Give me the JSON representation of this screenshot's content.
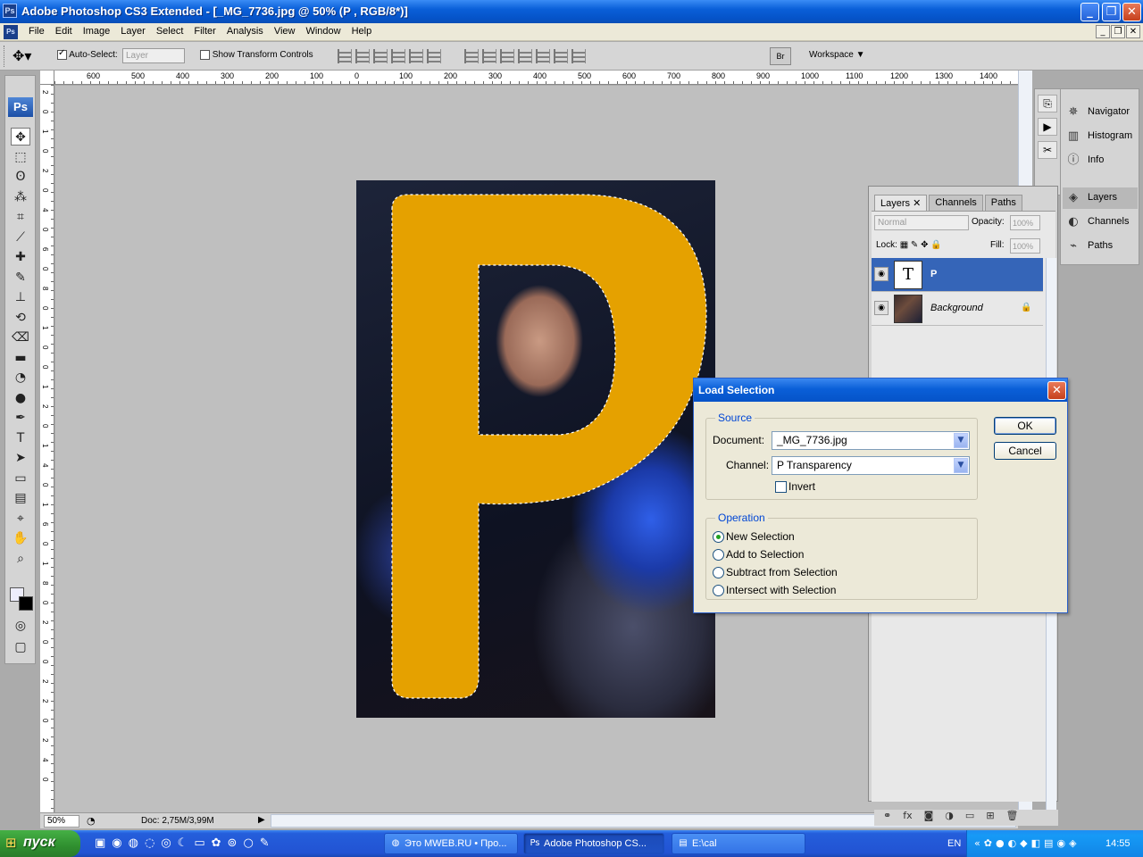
{
  "window": {
    "title": "Adobe Photoshop CS3 Extended - [_MG_7736.jpg @ 50% (P , RGB/8*)]",
    "app_badge": "Ps",
    "minimize_icon": "minimize-icon",
    "maximize_icon": "maximize-icon",
    "close_icon": "close-icon"
  },
  "menubar": {
    "items": [
      "File",
      "Edit",
      "Image",
      "Layer",
      "Select",
      "Filter",
      "Analysis",
      "View",
      "Window",
      "Help"
    ]
  },
  "options": {
    "auto_select_label": "Auto-Select:",
    "auto_select_checked": true,
    "auto_select_target": "Layer",
    "show_transform_label": "Show Transform Controls",
    "show_transform_checked": false,
    "bridge_label": "Br",
    "workspace_label": "Workspace ▼"
  },
  "toolbox": {
    "badge": "Ps",
    "tools": [
      "move-tool",
      "marquee-tool",
      "lasso-tool",
      "magic-wand-tool",
      "crop-tool",
      "slice-tool",
      "healing-brush-tool",
      "brush-tool",
      "clone-stamp-tool",
      "history-brush-tool",
      "eraser-tool",
      "gradient-tool",
      "blur-tool",
      "dodge-tool",
      "pen-tool",
      "type-tool",
      "path-selection-tool",
      "shape-tool",
      "notes-tool",
      "eyedropper-tool",
      "hand-tool",
      "zoom-tool"
    ]
  },
  "rulers": {
    "top_labels": [
      "600",
      "500",
      "400",
      "300",
      "200",
      "100",
      "0",
      "100",
      "200",
      "300",
      "400",
      "500",
      "600",
      "700",
      "800",
      "900",
      "1000",
      "1100",
      "1200",
      "1300",
      "1400"
    ],
    "left_labels": [
      "2",
      "0",
      "1",
      "0",
      "2",
      "0",
      "4",
      "0",
      "6",
      "0",
      "8",
      "0",
      "1",
      "0",
      "0",
      "1",
      "2",
      "0",
      "1",
      "4",
      "0",
      "1",
      "6",
      "0",
      "1",
      "8",
      "0",
      "2",
      "0",
      "0",
      "2",
      "2",
      "0",
      "2",
      "4",
      "0"
    ]
  },
  "document": {
    "overlay_letter": "P",
    "letter_color": "#e5a100",
    "zoom": "50%",
    "doc_info": "Doc: 2,75M/3,99M"
  },
  "dock": {
    "items": [
      {
        "label": "Navigator",
        "icon": "navigator-icon"
      },
      {
        "label": "Histogram",
        "icon": "histogram-icon"
      },
      {
        "label": "Info",
        "icon": "info-icon"
      },
      {
        "label": "Layers",
        "icon": "layers-icon"
      },
      {
        "label": "Channels",
        "icon": "channels-icon"
      },
      {
        "label": "Paths",
        "icon": "paths-icon"
      }
    ]
  },
  "layers_panel": {
    "tabs": [
      "Layers ✕",
      "Channels",
      "Paths"
    ],
    "blend_mode": "Normal",
    "opacity_label": "Opacity:",
    "opacity_value": "100%",
    "lock_label": "Lock:",
    "fill_label": "Fill:",
    "fill_value": "100%",
    "layers": [
      {
        "name": "P",
        "type": "text",
        "thumb": "T",
        "selected": true
      },
      {
        "name": "Background",
        "type": "image",
        "thumb": "",
        "selected": false,
        "locked": true
      }
    ],
    "footer_icons": [
      "link-icon",
      "fx-icon",
      "mask-icon",
      "adjustment-icon",
      "folder-icon",
      "new-layer-icon",
      "trash-icon"
    ]
  },
  "dialog": {
    "title": "Load Selection",
    "source_legend": "Source",
    "document_label": "Document:",
    "document_value": "_MG_7736.jpg",
    "channel_label": "Channel:",
    "channel_value": "P Transparency",
    "invert_label": "Invert",
    "invert_checked": false,
    "operation_legend": "Operation",
    "operations": [
      {
        "label": "New Selection",
        "selected": true
      },
      {
        "label": "Add to Selection",
        "selected": false
      },
      {
        "label": "Subtract from Selection",
        "selected": false
      },
      {
        "label": "Intersect with Selection",
        "selected": false
      }
    ],
    "ok_label": "OK",
    "cancel_label": "Cancel"
  },
  "taskbar": {
    "start_label": "пуск",
    "tasks": [
      {
        "label": "Это MWEB.RU • Про...",
        "icon": "firefox-icon",
        "active": false
      },
      {
        "label": "Adobe Photoshop CS...",
        "icon": "photoshop-icon",
        "active": true
      },
      {
        "label": "E:\\cal",
        "icon": "folder-icon",
        "active": false
      }
    ],
    "language": "EN",
    "clock": "14:55"
  }
}
